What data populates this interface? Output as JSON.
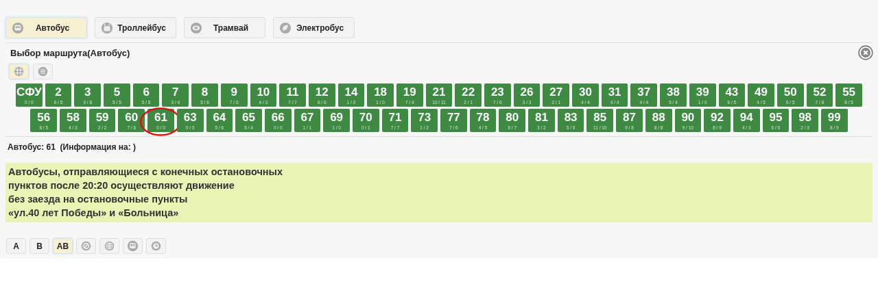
{
  "transport_tabs": [
    {
      "label": "Автобус",
      "kind": "bus",
      "selected": true
    },
    {
      "label": "Троллейбус",
      "kind": "trolleybus",
      "selected": false
    },
    {
      "label": "Трамвай",
      "kind": "tram",
      "selected": false
    },
    {
      "label": "Электробус",
      "kind": "ebus",
      "selected": false
    }
  ],
  "panel_title": "Выбор маршрута(Автобус)",
  "view_toggles": [
    {
      "kind": "grid",
      "selected": true
    },
    {
      "kind": "list",
      "selected": false
    }
  ],
  "route_rows": [
    [
      {
        "number": "СФУ",
        "count": "0 / 0",
        "circled": false
      },
      {
        "number": "2",
        "count": "6 / 5",
        "circled": false
      },
      {
        "number": "3",
        "count": "9 / 8",
        "circled": false
      },
      {
        "number": "5",
        "count": "5 / 5",
        "circled": false
      },
      {
        "number": "6",
        "count": "5 / 5",
        "circled": false
      },
      {
        "number": "7",
        "count": "3 / 4",
        "circled": false
      },
      {
        "number": "8",
        "count": "5 / 6",
        "circled": false
      },
      {
        "number": "9",
        "count": "7 / 6",
        "circled": false
      },
      {
        "number": "10",
        "count": "4 / 3",
        "circled": false
      },
      {
        "number": "11",
        "count": "7 / 7",
        "circled": false
      },
      {
        "number": "12",
        "count": "6 / 6",
        "circled": false
      },
      {
        "number": "14",
        "count": "1 / 0",
        "circled": false
      },
      {
        "number": "18",
        "count": "1 / 0",
        "circled": false
      },
      {
        "number": "19",
        "count": "7 / 4",
        "circled": false
      },
      {
        "number": "21",
        "count": "10 / 11",
        "circled": false
      },
      {
        "number": "22",
        "count": "2 / 1",
        "circled": false
      },
      {
        "number": "23",
        "count": "7 / 6",
        "circled": false
      },
      {
        "number": "26",
        "count": "3 / 3",
        "circled": false
      },
      {
        "number": "27",
        "count": "2 / 1",
        "circled": false
      },
      {
        "number": "30",
        "count": "4 / 4",
        "circled": false
      },
      {
        "number": "31",
        "count": "4 / 4",
        "circled": false
      },
      {
        "number": "37",
        "count": "4 / 4",
        "circled": false
      },
      {
        "number": "38",
        "count": "5 / 4",
        "circled": false
      },
      {
        "number": "39",
        "count": "1 / 0",
        "circled": false
      },
      {
        "number": "43",
        "count": "6 / 5",
        "circled": false
      },
      {
        "number": "49",
        "count": "4 / 5",
        "circled": false
      },
      {
        "number": "50",
        "count": "6 / 5",
        "circled": false
      },
      {
        "number": "52",
        "count": "7 / 8",
        "circled": false
      },
      {
        "number": "55",
        "count": "8 / 5",
        "circled": false
      }
    ],
    [
      {
        "number": "56",
        "count": "8 / 5",
        "circled": false
      },
      {
        "number": "58",
        "count": "4 / 3",
        "circled": false
      },
      {
        "number": "59",
        "count": "2 / 2",
        "circled": false
      },
      {
        "number": "60",
        "count": "7 / 6",
        "circled": false
      },
      {
        "number": "61",
        "count": "0 / 0",
        "circled": true
      },
      {
        "number": "63",
        "count": "0 / 3",
        "circled": false
      },
      {
        "number": "64",
        "count": "5 / 6",
        "circled": false
      },
      {
        "number": "65",
        "count": "5 / 4",
        "circled": false
      },
      {
        "number": "66",
        "count": "0 / 0",
        "circled": false
      },
      {
        "number": "67",
        "count": "1 / 1",
        "circled": false
      },
      {
        "number": "69",
        "count": "1 / 0",
        "circled": false
      },
      {
        "number": "70",
        "count": "0 / 1",
        "circled": false
      },
      {
        "number": "71",
        "count": "7 / 7",
        "circled": false
      },
      {
        "number": "73",
        "count": "1 / 2",
        "circled": false
      },
      {
        "number": "77",
        "count": "7 / 6",
        "circled": false
      },
      {
        "number": "78",
        "count": "4 / 5",
        "circled": false
      },
      {
        "number": "80",
        "count": "6 / 7",
        "circled": false
      },
      {
        "number": "81",
        "count": "3 / 2",
        "circled": false
      },
      {
        "number": "83",
        "count": "5 / 6",
        "circled": false
      },
      {
        "number": "85",
        "count": "11 / 10",
        "circled": false
      },
      {
        "number": "87",
        "count": "9 / 8",
        "circled": false
      },
      {
        "number": "88",
        "count": "8 / 8",
        "circled": false
      },
      {
        "number": "90",
        "count": "9 / 10",
        "circled": false
      },
      {
        "number": "92",
        "count": "8 / 9",
        "circled": false
      },
      {
        "number": "94",
        "count": "4 / 3",
        "circled": false
      },
      {
        "number": "95",
        "count": "6 / 6",
        "circled": false
      },
      {
        "number": "98",
        "count": "2 / 3",
        "circled": false
      },
      {
        "number": "99",
        "count": "8 / 9",
        "circled": false
      }
    ]
  ],
  "route_info": "Автобус: 61  (Информация на: )",
  "notice": "Автобусы, отправляющиеся с конечных остановочных\nпунктов после 20:20 осуществляют движение\nбез заезда на остановочные пункты\n«ул.40 лет Победы» и «Больница»",
  "direction_buttons": [
    {
      "kind": "text",
      "label": "A",
      "selected": false
    },
    {
      "kind": "text",
      "label": "B",
      "selected": false
    },
    {
      "kind": "text",
      "label": "AB",
      "selected": true
    },
    {
      "kind": "no-entry",
      "selected": false
    },
    {
      "kind": "target",
      "selected": false
    },
    {
      "kind": "bus",
      "selected": false
    },
    {
      "kind": "clock",
      "selected": false
    }
  ]
}
